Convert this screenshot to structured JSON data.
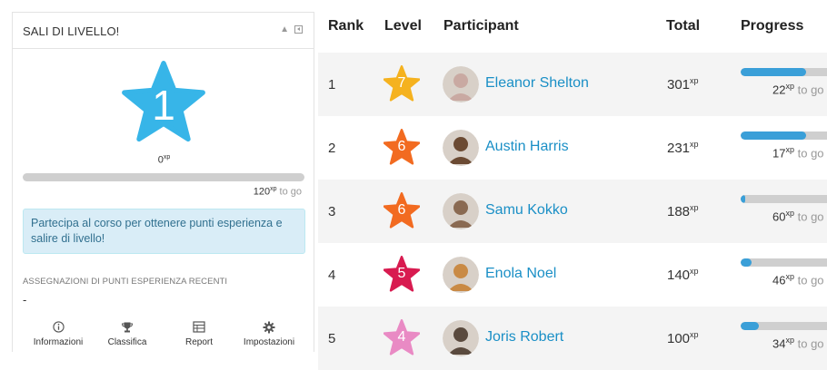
{
  "block": {
    "title": "SALI DI LIVELLO!",
    "collapse_glyph": "▲",
    "level": "1",
    "current_xp": "0",
    "xp_unit": "xp",
    "progress_fraction": 0,
    "xp_to_go": "120",
    "to_go_label": "to go",
    "info_message": "Partecipa al corso per ottenere punti esperienza e salire di livello!",
    "recent_title": "ASSEGNAZIONI DI PUNTI ESPERIENZA RECENTI",
    "recent_empty": "-",
    "nav": [
      {
        "label": "Informazioni",
        "icon": "info-icon"
      },
      {
        "label": "Classifica",
        "icon": "trophy-icon"
      },
      {
        "label": "Report",
        "icon": "report-icon"
      },
      {
        "label": "Impostazioni",
        "icon": "gear-icon"
      }
    ],
    "colors": {
      "star": "#37b5e8",
      "info_bg": "#d9edf7",
      "info_text": "#31708f"
    }
  },
  "leaderboard": {
    "headers": {
      "rank": "Rank",
      "level": "Level",
      "participant": "Participant",
      "total": "Total",
      "progress": "Progress"
    },
    "xp_unit": "xp",
    "to_go_label": "to go",
    "rows": [
      {
        "rank": "1",
        "level": "7",
        "level_color": "#f5b21f",
        "name": "Eleanor Shelton",
        "total": "301",
        "to_go": "22",
        "progress": 0.72,
        "avatar_color": "#c9a9a2"
      },
      {
        "rank": "2",
        "level": "6",
        "level_color": "#f26b21",
        "name": "Austin Harris",
        "total": "231",
        "to_go": "17",
        "progress": 0.72,
        "avatar_color": "#6b4a33"
      },
      {
        "rank": "3",
        "level": "6",
        "level_color": "#f26b21",
        "name": "Samu Kokko",
        "total": "188",
        "to_go": "60",
        "progress": 0.05,
        "avatar_color": "#8a6a52"
      },
      {
        "rank": "4",
        "level": "5",
        "level_color": "#d81b50",
        "name": "Enola Noel",
        "total": "140",
        "to_go": "46",
        "progress": 0.12,
        "avatar_color": "#c98a45"
      },
      {
        "rank": "5",
        "level": "4",
        "level_color": "#e98ac4",
        "name": "Joris Robert",
        "total": "100",
        "to_go": "34",
        "progress": 0.2,
        "avatar_color": "#5a4a3e"
      }
    ]
  }
}
